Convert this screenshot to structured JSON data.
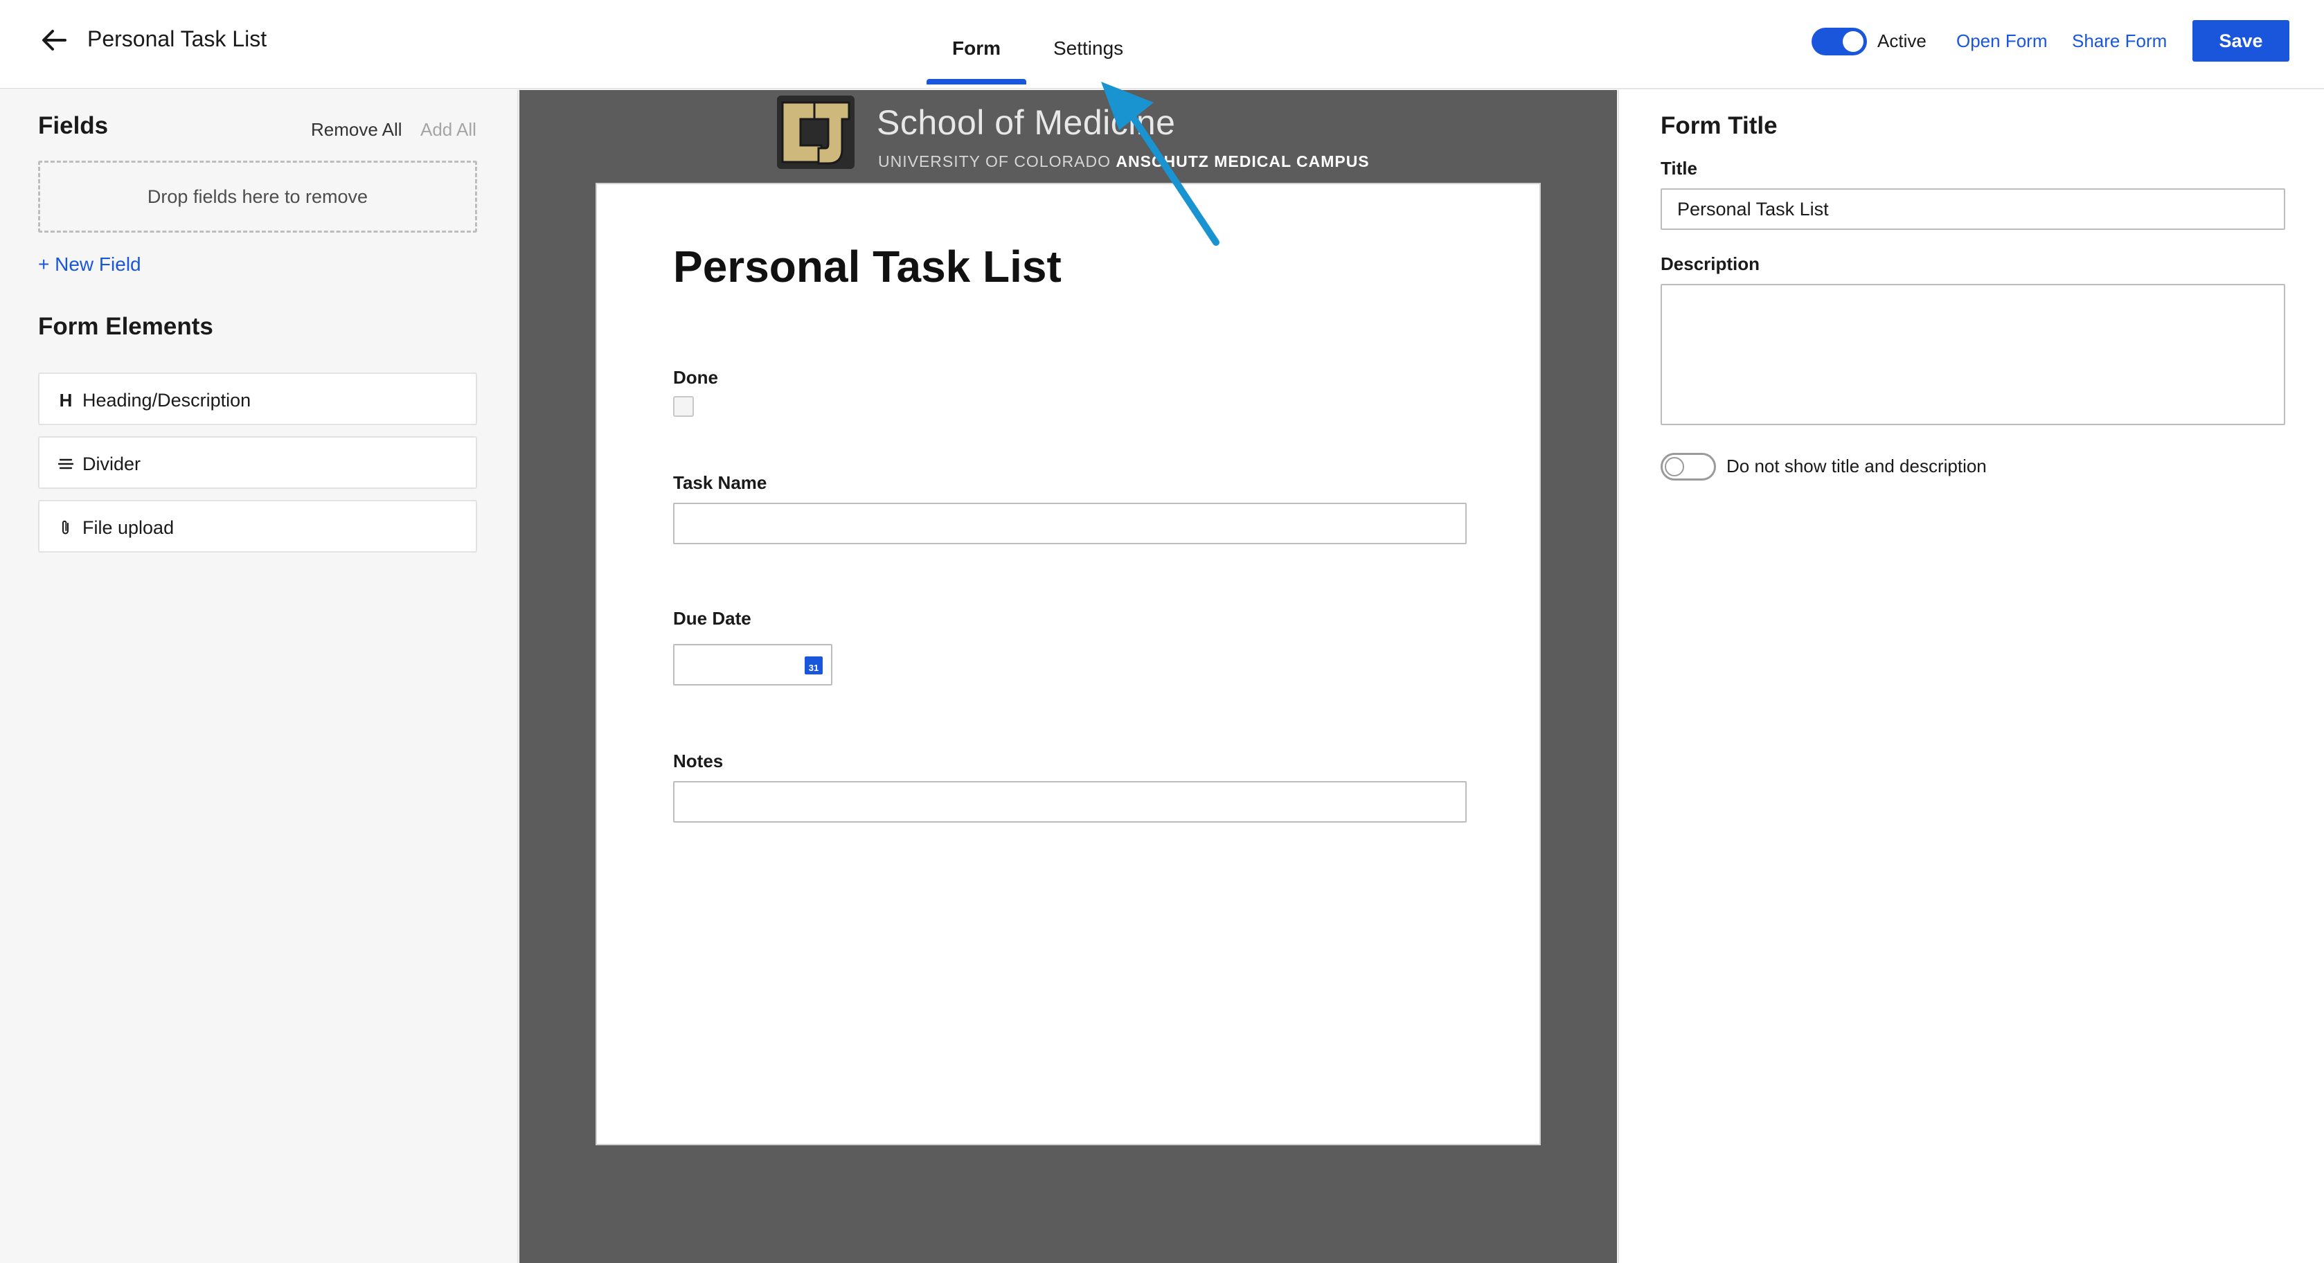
{
  "header": {
    "title": "Personal Task List",
    "tabs": [
      {
        "label": "Form",
        "selected": true
      },
      {
        "label": "Settings",
        "selected": false
      }
    ],
    "active_toggle": {
      "label": "Active",
      "on": true
    },
    "open_form_label": "Open Form",
    "share_form_label": "Share Form",
    "save_label": "Save"
  },
  "left_panel": {
    "fields_heading": "Fields",
    "remove_all_label": "Remove All",
    "add_all_label": "Add All",
    "drop_zone_text": "Drop fields here to remove",
    "new_field_label": "+ New Field",
    "form_elements_heading": "Form Elements",
    "elements": [
      {
        "icon": "heading-icon",
        "glyph": "H",
        "label": "Heading/Description"
      },
      {
        "icon": "divider-icon",
        "glyph": "",
        "label": "Divider"
      },
      {
        "icon": "paperclip-icon",
        "glyph": "",
        "label": "File upload"
      }
    ]
  },
  "canvas": {
    "logo": {
      "name": "School of Medicine",
      "subtitle_light": "UNIVERSITY OF COLORADO ",
      "subtitle_bold": "ANSCHUTZ MEDICAL CAMPUS"
    },
    "form": {
      "title": "Personal Task List",
      "fields": [
        {
          "label": "Done",
          "type": "checkbox"
        },
        {
          "label": "Task Name",
          "type": "text"
        },
        {
          "label": "Due Date",
          "type": "date",
          "calendar_glyph": "31"
        },
        {
          "label": "Notes",
          "type": "text"
        }
      ]
    }
  },
  "right_panel": {
    "heading": "Form Title",
    "title_label": "Title",
    "title_value": "Personal Task List",
    "description_label": "Description",
    "description_value": "",
    "hide_toggle": {
      "label": "Do not show title and description",
      "on": false
    }
  },
  "colors": {
    "accent": "#1a56db",
    "canvas_bg": "#5c5c5c",
    "panel_bg": "#f6f6f6",
    "annotation_arrow": "#1a93d1"
  }
}
